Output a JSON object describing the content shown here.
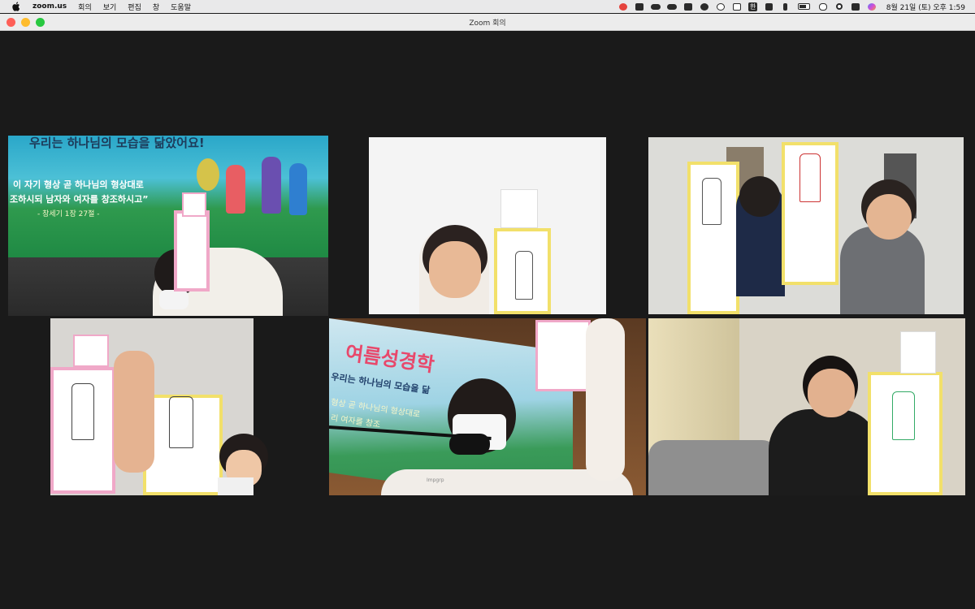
{
  "menubar": {
    "app_name": "zoom.us",
    "menus": [
      "회의",
      "보기",
      "편집",
      "창",
      "도움말"
    ],
    "status_icons": [
      "record-icon",
      "camera-icon",
      "cloud-icon",
      "cloud-icon",
      "grid-icon",
      "half-circle-icon",
      "play-icon",
      "window-icon",
      "hangul-icon",
      "volume-icon",
      "bluetooth-icon",
      "battery-icon",
      "link-icon",
      "search-icon",
      "control-center-icon",
      "siri-icon"
    ],
    "input_method": "한",
    "clock": "8월 21일 (토) 오후 1:59"
  },
  "window": {
    "title": "Zoom 회의"
  },
  "tiles": {
    "t1": {
      "banner_top": "우리는 하나님의 모습을 닮았어요!",
      "verse_line1": "이 자기 형상 곧 하나님의 형상대로",
      "verse_line2": "조하시되 남자와 여자를 창조하시고”",
      "verse_ref": "- 창세기 1장 27절 -"
    },
    "t5": {
      "banner_title": "여름성경학",
      "banner_sub": "우리는 하나님의 모습을 닮",
      "banner_verse1": "형상 곧 하나님의 형상대로",
      "banner_verse2": "리 여자를 창조",
      "mask_label": "Impgrp"
    }
  },
  "colors": {
    "active_speaker": "#d9e86a",
    "menubar_bg": "#e9e9ea",
    "window_bg": "#1a1a1a"
  }
}
